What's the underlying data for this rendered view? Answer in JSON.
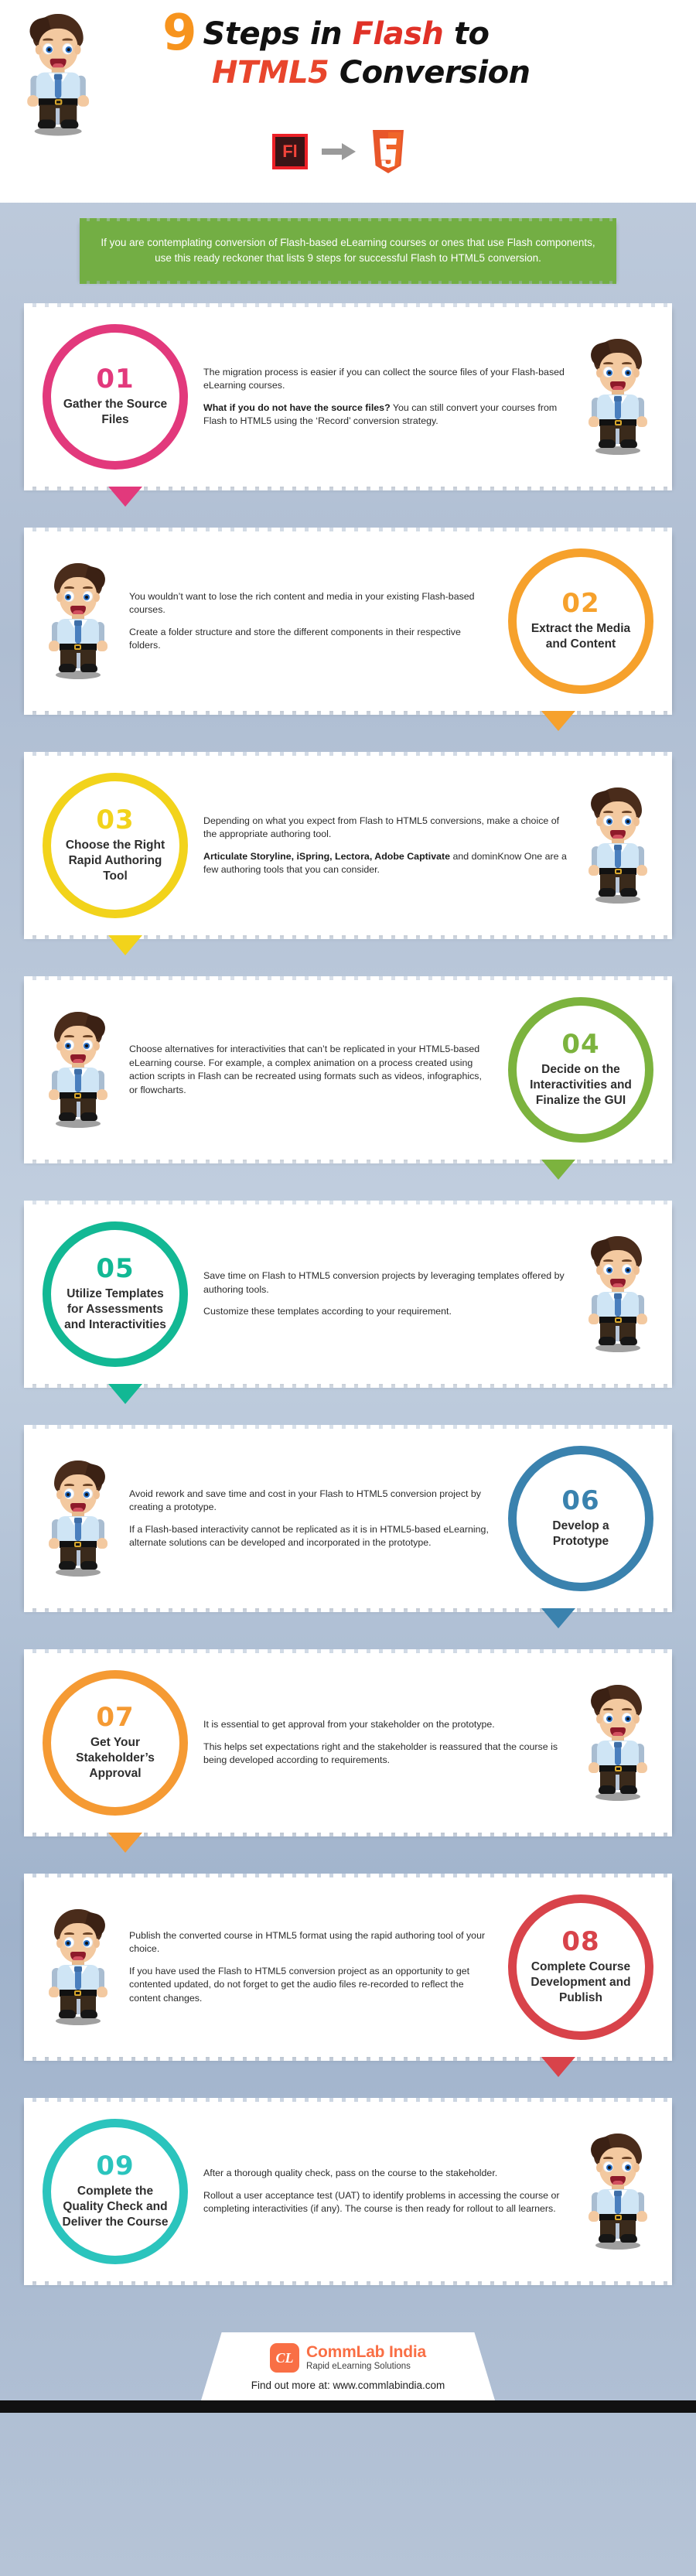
{
  "header": {
    "number": "9",
    "title_line1_a": "Steps in ",
    "title_line1_flash": "Flash",
    "title_line1_b": " to",
    "title_line2_html5": "HTML5",
    "title_line2_b": " Conversion",
    "flash_icon_label": "Fl",
    "html5_icon_label": "5",
    "arrow_icon": "arrow-right-icon"
  },
  "intro": {
    "text": "If you are contemplating conversion of Flash-based eLearning courses or ones that use Flash components, use this ready reckoner that lists 9 steps for successful Flash to HTML5 conversion."
  },
  "colors": {
    "pink": "#e2397c",
    "orange": "#f6a12c",
    "yellow": "#f2d31b",
    "green": "#7cb33e",
    "teal": "#12b894",
    "blue": "#3a82ae",
    "orange2": "#f59a33",
    "red": "#d8434a",
    "teal2": "#2bc4bd",
    "intro_green": "#73ae44",
    "brand_orange": "#f96f45",
    "title_orange": "#f7941e",
    "title_red": "#e03127"
  },
  "steps": [
    {
      "num": "01",
      "title": "Gather the Source Files",
      "color": "#e2397c",
      "circle_side": "left",
      "paragraphs": [
        {
          "text": "The migration process is easier if you can collect the source files of your Flash-based eLearning courses."
        },
        {
          "bold": "What if you do not have the source files?",
          "text": " You can still convert your courses from Flash to HTML5 using the ‘Record’ conversion strategy."
        }
      ]
    },
    {
      "num": "02",
      "title": "Extract the Media and Content",
      "color": "#f6a12c",
      "circle_side": "right",
      "paragraphs": [
        {
          "text": "You wouldn’t want to lose the rich content and media in your existing Flash-based courses."
        },
        {
          "text": "Create a folder structure and store the different components in their respective folders."
        }
      ]
    },
    {
      "num": "03",
      "title": "Choose the Right Rapid Authoring Tool",
      "color": "#f2d31b",
      "circle_side": "left",
      "paragraphs": [
        {
          "text": "Depending on what you expect from Flash to HTML5 conversions, make a choice of the appropriate authoring tool."
        },
        {
          "bold": "Articulate Storyline, iSpring, Lectora, Adobe Captivate",
          "text": " and dominKnow One are a few authoring tools that you can consider."
        }
      ]
    },
    {
      "num": "04",
      "title": "Decide on the Interactivities and Finalize the GUI",
      "color": "#7cb33e",
      "circle_side": "right",
      "paragraphs": [
        {
          "text": "Choose alternatives for interactivities that can’t be replicated in your HTML5-based eLearning course. For example, a complex animation on a process created using action scripts in Flash can be recreated using formats such as videos, infographics, or flowcharts."
        }
      ]
    },
    {
      "num": "05",
      "title": "Utilize Templates for Assessments and Interactivities",
      "color": "#12b894",
      "circle_side": "left",
      "paragraphs": [
        {
          "text": "Save time on Flash to HTML5 conversion projects by leveraging templates offered by authoring tools."
        },
        {
          "text": "Customize these templates according to your requirement."
        }
      ]
    },
    {
      "num": "06",
      "title": "Develop a Prototype",
      "color": "#3a82ae",
      "circle_side": "right",
      "paragraphs": [
        {
          "text": "Avoid rework and save time and cost in your Flash to HTML5 conversion project by creating a prototype."
        },
        {
          "text": "If a Flash-based interactivity cannot be replicated as it is in HTML5-based eLearning, alternate solutions can be developed and incorporated in the prototype."
        }
      ]
    },
    {
      "num": "07",
      "title": "Get Your Stakeholder’s Approval",
      "color": "#f59a33",
      "circle_side": "left",
      "paragraphs": [
        {
          "text": "It is essential to get approval from your stakeholder on the prototype."
        },
        {
          "text": "This helps set expectations right and the stakeholder is reassured that the course is being developed according to requirements."
        }
      ]
    },
    {
      "num": "08",
      "title": "Complete Course Development and Publish",
      "color": "#d8434a",
      "circle_side": "right",
      "paragraphs": [
        {
          "text": "Publish the converted course in HTML5 format using the rapid authoring tool of your choice."
        },
        {
          "text": "If you have used the Flash to HTML5 conversion project as an opportunity to get contented updated, do not forget to get the audio files re-recorded to reflect the content changes."
        }
      ]
    },
    {
      "num": "09",
      "title": "Complete the Quality Check and Deliver the Course",
      "color": "#2bc4bd",
      "circle_side": "left",
      "paragraphs": [
        {
          "text": "After a thorough quality check, pass on the course to the stakeholder."
        },
        {
          "text": "Rollout a user acceptance test (UAT) to identify problems in accessing the course or completing interactivities (if any). The course is then ready for rollout to all learners."
        }
      ]
    }
  ],
  "footer": {
    "logo_mark": "CL",
    "logo_name": "CommLab India",
    "logo_sub": "Rapid eLearning Solutions",
    "find_out": "Find out more at:  www.commlabindia.com"
  }
}
